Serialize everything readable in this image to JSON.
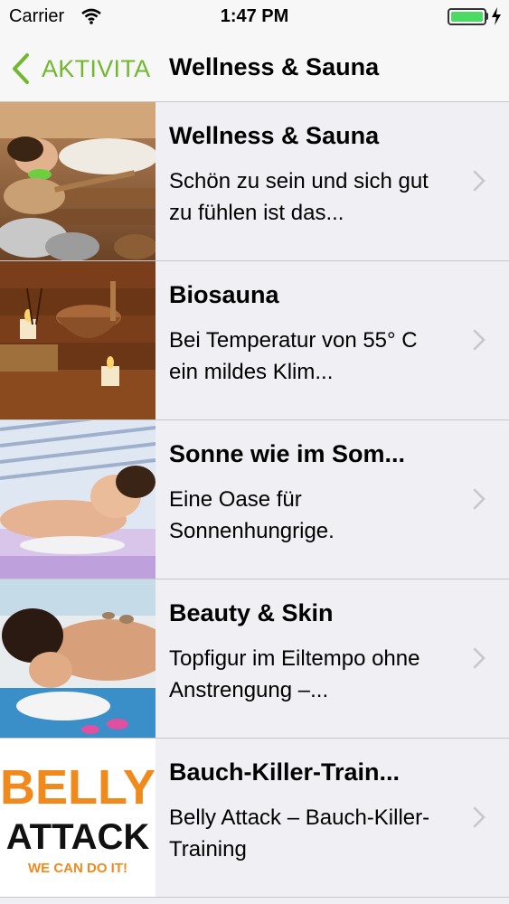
{
  "status": {
    "carrier": "Carrier",
    "time": "1:47 PM"
  },
  "nav": {
    "back_label": "AKTIVITA",
    "title": "Wellness & Sauna"
  },
  "colors": {
    "accent": "#72b82f",
    "battery": "#4cd964"
  },
  "items": [
    {
      "title": "Wellness & Sauna",
      "subtitle": "Schön zu sein und sich gut zu fühlen ist das..."
    },
    {
      "title": "Biosauna",
      "subtitle": "Bei Temperatur von 55° C ein mildes Klim..."
    },
    {
      "title": "Sonne wie im Som...",
      "subtitle": "Eine Oase für Sonnenhungrige."
    },
    {
      "title": "Beauty & Skin",
      "subtitle": "Topfigur im Eiltempo ohne Anstrengung –..."
    },
    {
      "title": "Bauch-Killer-Train...",
      "subtitle": "Belly Attack – Bauch-Killer-Training"
    }
  ],
  "belly_logo": {
    "line1": "BELLY",
    "line2": "ATTACK",
    "line3": "WE CAN DO IT!"
  }
}
